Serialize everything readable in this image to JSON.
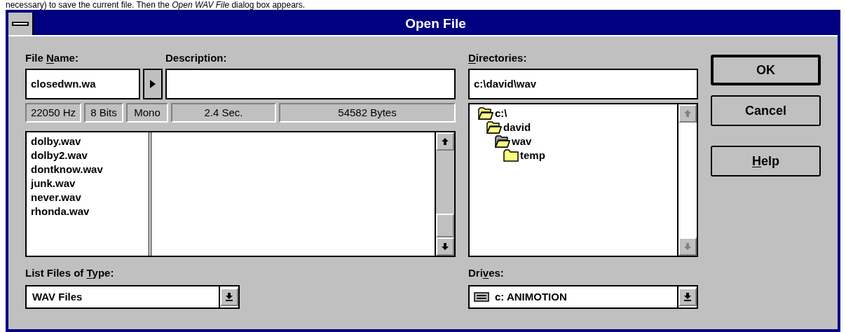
{
  "caption": "necessary) to save the current file. Then the *Open WAV File* dialog box appears.",
  "window": {
    "title": "Open File"
  },
  "file_name": {
    "label_parts": [
      {
        "text": "File ",
        "underline": false
      },
      {
        "text": "N",
        "underline": true
      },
      {
        "text": "ame:",
        "underline": false
      }
    ],
    "value": "closedwn.wa"
  },
  "description": {
    "label": "Description:"
  },
  "info": [
    "22050 Hz",
    "8 Bits",
    "Mono",
    "2.4 Sec.",
    "54582 Bytes"
  ],
  "files": [
    "dolby.wav",
    "dolby2.wav",
    "dontknow.wav",
    "junk.wav",
    "never.wav",
    "rhonda.wav"
  ],
  "directories": {
    "label_parts": [
      {
        "text": "D",
        "underline": true
      },
      {
        "text": "irectories:",
        "underline": false
      }
    ],
    "path": "c:\\david\\wav",
    "tree": [
      {
        "name": "c:\\",
        "kind": "open",
        "children": [
          {
            "name": "david",
            "kind": "open",
            "children": [
              {
                "name": "wav",
                "kind": "current",
                "children": [
                  {
                    "name": "temp",
                    "kind": "closed"
                  }
                ]
              }
            ]
          }
        ]
      }
    ]
  },
  "type_combo": {
    "label_parts": [
      {
        "text": "List Files of ",
        "underline": false
      },
      {
        "text": "T",
        "underline": true
      },
      {
        "text": "ype:",
        "underline": false
      }
    ],
    "value": "WAV Files"
  },
  "drives": {
    "label_parts": [
      {
        "text": "Dri",
        "underline": false
      },
      {
        "text": "v",
        "underline": true
      },
      {
        "text": "es:",
        "underline": false
      }
    ],
    "value": "c: ANIMOTION"
  },
  "buttons": [
    {
      "label_parts": [
        {
          "text": "OK",
          "underline": false
        }
      ],
      "default": true
    },
    {
      "label_parts": [
        {
          "text": "Cancel",
          "underline": false
        }
      ],
      "default": false
    },
    {
      "label_parts": [
        {
          "text": "H",
          "underline": true
        },
        {
          "text": "elp",
          "underline": false
        }
      ],
      "default": false
    }
  ]
}
